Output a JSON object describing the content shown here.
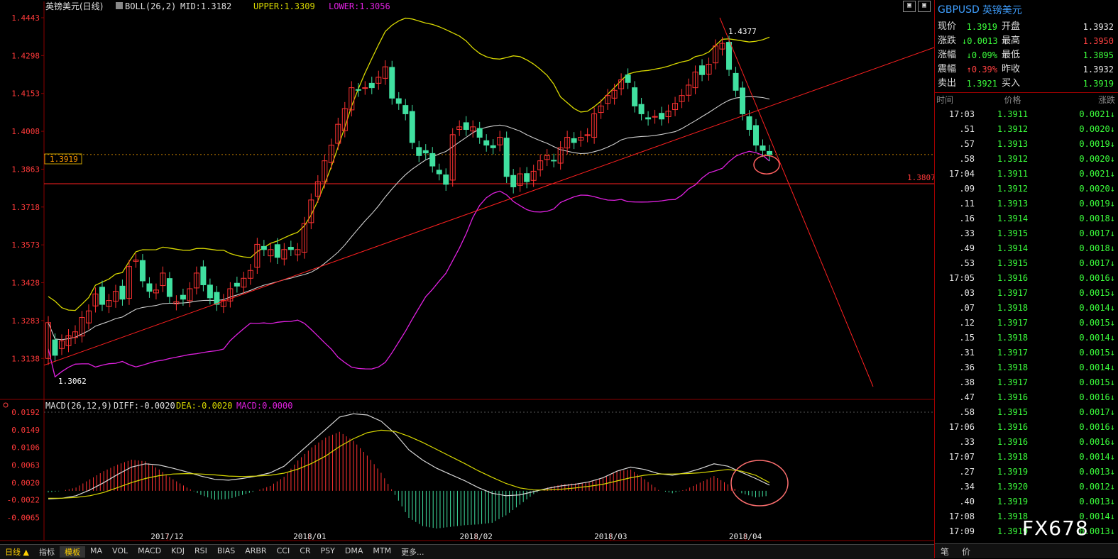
{
  "header": {
    "instrument": "英镑美元(日线)",
    "indicator": "BOLL(26,2)",
    "mid": "MID:1.3182",
    "upper": "UPPER:1.3309",
    "lower": "LOWER:1.3056"
  },
  "macd_header": {
    "name": "MACD(26,12,9)",
    "diff": "DIFF:-0.0020",
    "dea": "DEA:-0.0020",
    "macd": "MACD:0.0000"
  },
  "colors": {
    "upper": "#d8d800",
    "mid": "#d0d0d0",
    "lower": "#e020e0",
    "up_candle": "#ff3232",
    "down_candle": "#40e0a0",
    "trend": "#ff2020",
    "axis_text": "#ff3a3a"
  },
  "annotations": {
    "current_price_tag": "1.3919",
    "support_tag": "1.3807",
    "high_label": "1.4377",
    "low_label": "1.3062"
  },
  "chart_data": [
    {
      "type": "candlestick",
      "ylim": [
        1.303,
        1.4443
      ],
      "y_ticks": [
        "1.4443",
        "1.4298",
        "1.4153",
        "1.4008",
        "1.3863",
        "1.3718",
        "1.3573",
        "1.3428",
        "1.3283",
        "1.3138"
      ],
      "x_ticks": [
        "2017/12",
        "2018/01",
        "2018/02",
        "2018/03",
        "2018/04"
      ],
      "grid": false,
      "close": [
        1.3275,
        1.315,
        1.3205,
        1.3225,
        1.324,
        1.3295,
        1.332,
        1.3385,
        1.3345,
        1.336,
        1.3395,
        1.3365,
        1.349,
        1.3515,
        1.3435,
        1.3395,
        1.34,
        1.3465,
        1.3375,
        1.3355,
        1.3365,
        1.3405,
        1.3465,
        1.342,
        1.337,
        1.3345,
        1.336,
        1.3405,
        1.3415,
        1.3445,
        1.3475,
        1.3575,
        1.3555,
        1.3555,
        1.3525,
        1.3555,
        1.3555,
        1.3555,
        1.3655,
        1.3745,
        1.3815,
        1.3895,
        1.3955,
        1.4035,
        1.4095,
        1.4175,
        1.4165,
        1.4175,
        1.4175,
        1.4215,
        1.4255,
        1.4135,
        1.4115,
        1.4075,
        1.3965,
        1.3915,
        1.3925,
        1.3875,
        1.3845,
        1.3805,
        1.3995,
        1.4025,
        1.4015,
        1.4025,
        1.3985,
        1.3955,
        1.3945,
        1.3985,
        1.3835,
        1.3795,
        1.3845,
        1.3815,
        1.3855,
        1.3895,
        1.3915,
        1.3895,
        1.3945,
        1.3985,
        1.3965,
        1.3985,
        1.3995,
        1.4075,
        1.4105,
        1.4145,
        1.4165,
        1.4205,
        1.4195,
        1.4105,
        1.4075,
        1.4055,
        1.4065,
        1.4055,
        1.4085,
        1.4115,
        1.4145,
        1.4185,
        1.4235,
        1.4225,
        1.4265,
        1.4335,
        1.4345,
        1.4245,
        1.4165,
        1.4075,
        1.4015,
        1.3955,
        1.3935,
        1.3919
      ],
      "open": [
        1.3138,
        1.3209,
        1.3176,
        1.3187,
        1.3218,
        1.3224,
        1.3274,
        1.3339,
        1.3411,
        1.3337,
        1.3357,
        1.3415,
        1.3368,
        1.351,
        1.3513,
        1.3424,
        1.3389,
        1.3417,
        1.3444,
        1.3347,
        1.338,
        1.3359,
        1.3408,
        1.3489,
        1.3419,
        1.3391,
        1.3337,
        1.3358,
        1.3426,
        1.3411,
        1.3445,
        1.3487,
        1.3567,
        1.3531,
        1.3574,
        1.3519,
        1.3564,
        1.3535,
        1.3545,
        1.3658,
        1.3759,
        1.3814,
        1.3888,
        1.3962,
        1.401,
        1.409,
        1.4168,
        1.4173,
        1.4192,
        1.4192,
        1.4211,
        1.4253,
        1.4133,
        1.4107,
        1.4084,
        1.3946,
        1.3934,
        1.3923,
        1.3859,
        1.3841,
        1.3821,
        1.4015,
        1.4041,
        1.4009,
        1.4019,
        1.3972,
        1.3953,
        1.3956,
        1.3982,
        1.3839,
        1.3801,
        1.3846,
        1.382,
        1.386,
        1.39,
        1.3897,
        1.3886,
        1.3944,
        1.398,
        1.3974,
        1.3991,
        1.3985,
        1.408,
        1.4115,
        1.4135,
        1.4171,
        1.4224,
        1.4175,
        1.4111,
        1.406,
        1.4062,
        1.4077,
        1.4064,
        1.4091,
        1.4122,
        1.4146,
        1.4175,
        1.4259,
        1.4227,
        1.427,
        1.4323,
        1.4349,
        1.423,
        1.4174,
        1.4064,
        1.403,
        1.3952,
        1.3931
      ]
    },
    {
      "type": "bar",
      "title": "MACD(26,12,9)",
      "ylim": [
        -0.0092,
        0.0192
      ],
      "y_ticks": [
        "0.0192",
        "0.0149",
        "0.0106",
        "0.0063",
        "0.0020",
        "-0.0022",
        "-0.0065"
      ],
      "series": [
        {
          "name": "DIFF",
          "type": "line",
          "values": [
            -0.002,
            -0.0018,
            -0.0012,
            0.0002,
            0.002,
            0.004,
            0.0058,
            0.0066,
            0.0063,
            0.0055,
            0.0046,
            0.0036,
            0.0028,
            0.0026,
            0.003,
            0.0036,
            0.0044,
            0.006,
            0.009,
            0.012,
            0.015,
            0.018,
            0.0188,
            0.0185,
            0.017,
            0.014,
            0.01,
            0.0075,
            0.0055,
            0.004,
            0.0025,
            0.0008,
            -0.0006,
            -0.0012,
            -0.001,
            -0.0002,
            0.0006,
            0.0012,
            0.0016,
            0.0022,
            0.0032,
            0.0048,
            0.0058,
            0.0052,
            0.0042,
            0.0038,
            0.0044,
            0.0054,
            0.0066,
            0.006,
            0.0045,
            0.003,
            0.0014
          ]
        },
        {
          "name": "DEA",
          "type": "line",
          "values": [
            -0.0018,
            -0.0018,
            -0.0016,
            -0.0012,
            -0.0004,
            0.0008,
            0.002,
            0.003,
            0.0037,
            0.0041,
            0.0042,
            0.0041,
            0.0039,
            0.0036,
            0.0035,
            0.0036,
            0.0038,
            0.0043,
            0.0053,
            0.0067,
            0.0085,
            0.0108,
            0.0127,
            0.0142,
            0.0148,
            0.0145,
            0.0133,
            0.0118,
            0.0101,
            0.0084,
            0.0067,
            0.0049,
            0.0033,
            0.0018,
            0.0007,
            0.0002,
            0.0002,
            0.0004,
            0.0007,
            0.0011,
            0.0016,
            0.0024,
            0.0032,
            0.0038,
            0.0041,
            0.0041,
            0.0042,
            0.0044,
            0.0048,
            0.0052,
            0.0048,
            0.0038,
            0.002
          ]
        }
      ]
    }
  ],
  "panel": {
    "symbol": "GBPUSD",
    "name": "英镑美元",
    "quote": [
      {
        "l1": "现价",
        "v1": "1.3919",
        "c1": "#3cff3c",
        "l2": "开盘",
        "v2": "1.3932",
        "c2": "#e8e8e8"
      },
      {
        "l1": "涨跌",
        "v1": "↓0.0013",
        "c1": "#3cff3c",
        "l2": "最高",
        "v2": "1.3950",
        "c2": "#ff4040"
      },
      {
        "l1": "涨幅",
        "v1": "↓0.09%",
        "c1": "#3cff3c",
        "l2": "最低",
        "v2": "1.3895",
        "c2": "#3cff3c"
      },
      {
        "l1": "震幅",
        "v1": "↑0.39%",
        "c1": "#ff4040",
        "l2": "昨收",
        "v2": "1.3932",
        "c2": "#e8e8e8"
      },
      {
        "l1": "卖出",
        "v1": "1.3921",
        "c1": "#3cff3c",
        "l2": "买入",
        "v2": "1.3919",
        "c2": "#3cff3c"
      }
    ],
    "table_head": [
      "时间",
      "价格",
      "涨跌"
    ],
    "ticks": [
      [
        "17:03",
        "1.3911",
        "0.0021↓"
      ],
      [
        ".51",
        "1.3912",
        "0.0020↓"
      ],
      [
        ".57",
        "1.3913",
        "0.0019↓"
      ],
      [
        ".58",
        "1.3912",
        "0.0020↓"
      ],
      [
        "17:04",
        "1.3911",
        "0.0021↓"
      ],
      [
        ".09",
        "1.3912",
        "0.0020↓"
      ],
      [
        ".11",
        "1.3913",
        "0.0019↓"
      ],
      [
        ".16",
        "1.3914",
        "0.0018↓"
      ],
      [
        ".33",
        "1.3915",
        "0.0017↓"
      ],
      [
        ".49",
        "1.3914",
        "0.0018↓"
      ],
      [
        ".53",
        "1.3915",
        "0.0017↓"
      ],
      [
        "17:05",
        "1.3916",
        "0.0016↓"
      ],
      [
        ".03",
        "1.3917",
        "0.0015↓"
      ],
      [
        ".07",
        "1.3918",
        "0.0014↓"
      ],
      [
        ".12",
        "1.3917",
        "0.0015↓"
      ],
      [
        ".15",
        "1.3918",
        "0.0014↓"
      ],
      [
        ".31",
        "1.3917",
        "0.0015↓"
      ],
      [
        ".36",
        "1.3918",
        "0.0014↓"
      ],
      [
        ".38",
        "1.3917",
        "0.0015↓"
      ],
      [
        ".47",
        "1.3916",
        "0.0016↓"
      ],
      [
        ".58",
        "1.3915",
        "0.0017↓"
      ],
      [
        "17:06",
        "1.3916",
        "0.0016↓"
      ],
      [
        ".33",
        "1.3916",
        "0.0016↓"
      ],
      [
        "17:07",
        "1.3918",
        "0.0014↓"
      ],
      [
        ".27",
        "1.3919",
        "0.0013↓"
      ],
      [
        ".34",
        "1.3920",
        "0.0012↓"
      ],
      [
        ".40",
        "1.3919",
        "0.0013↓"
      ],
      [
        "17:08",
        "1.3918",
        "0.0014↓"
      ],
      [
        "17:09",
        "1.3919",
        "0.0013↓"
      ]
    ],
    "bottom_tabs": [
      "笔",
      "价"
    ]
  },
  "bottombar": {
    "period": "日线",
    "tabs": [
      "指标",
      "模板",
      "MA",
      "VOL",
      "MACD",
      "KDJ",
      "RSI",
      "BIAS",
      "ARBR",
      "CCI",
      "CR",
      "PSY",
      "DMA",
      "MTM",
      "更多..."
    ]
  },
  "watermark": "FX678"
}
